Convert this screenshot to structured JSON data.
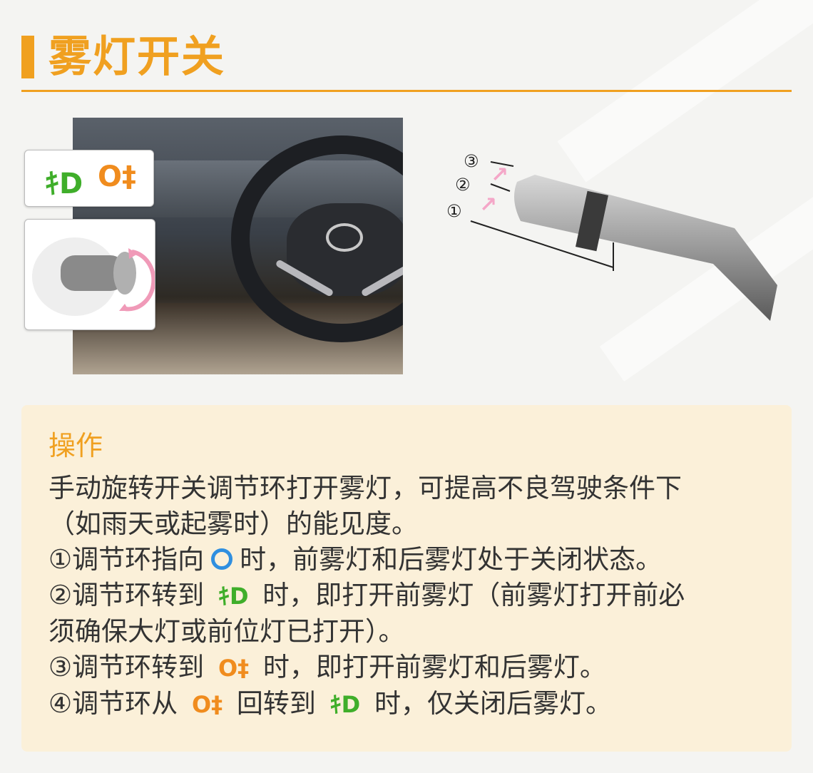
{
  "header": {
    "title": "雾灯开关"
  },
  "callouts": {
    "front_fog_glyph": "ｷD",
    "rear_fog_glyph": "O‡"
  },
  "stalk": {
    "labels": [
      "③",
      "②",
      "①"
    ]
  },
  "panel": {
    "heading": "操作",
    "lines": [
      "手动旋转开关调节环打开雾灯，可提高不良驾驶条件下",
      "（如雨天或起雾时）的能见度。"
    ],
    "step1": {
      "prefix": "①调节环指向",
      "suffix": "时，前雾灯和后雾灯处于关闭状态。"
    },
    "step2": {
      "prefix": "②调节环转到",
      "suffix": "时，即打开前雾灯（前雾灯打开前必"
    },
    "step2b": "须确保大灯或前位灯已打开）。",
    "step3": {
      "prefix": "③调节环转到",
      "suffix": "时，即打开前雾灯和后雾灯。"
    },
    "step4": {
      "prefix": "④调节环从",
      "middle": "回转到",
      "suffix": "时，仅关闭后雾灯。"
    }
  },
  "colors": {
    "accent": "#f0a020",
    "front_fog": "#3fae2a",
    "rear_fog": "#f08c1e",
    "off_ring": "#2f8fe0",
    "panel_bg": "#fbf0d9"
  }
}
